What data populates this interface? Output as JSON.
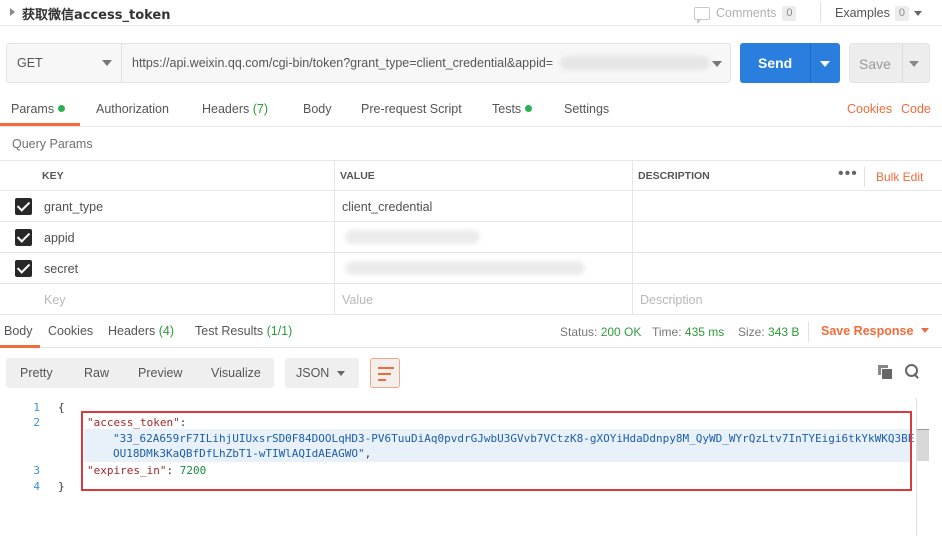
{
  "header": {
    "title": "获取微信access_token",
    "comments_label": "Comments",
    "comments_count": "0",
    "examples_label": "Examples",
    "examples_count": "0"
  },
  "request": {
    "method": "GET",
    "url": "https://api.weixin.qq.com/cgi-bin/token?grant_type=client_credential&appid=",
    "send_label": "Send",
    "save_label": "Save"
  },
  "request_tabs": {
    "params": "Params",
    "authorization": "Authorization",
    "headers": "Headers",
    "headers_count": "(7)",
    "body": "Body",
    "prerequest": "Pre-request Script",
    "tests": "Tests",
    "settings": "Settings",
    "cookies": "Cookies",
    "code": "Code"
  },
  "query_params": {
    "title": "Query Params",
    "columns": [
      "KEY",
      "VALUE",
      "DESCRIPTION"
    ],
    "bulk_edit": "Bulk Edit",
    "more": "•••",
    "rows": [
      {
        "key": "grant_type",
        "value": "client_credential"
      },
      {
        "key": "appid",
        "value": ""
      },
      {
        "key": "secret",
        "value": ""
      }
    ],
    "placeholder": {
      "key": "Key",
      "value": "Value",
      "description": "Description"
    }
  },
  "response_tabs": {
    "body": "Body",
    "cookies": "Cookies",
    "headers": "Headers",
    "headers_count": "(4)",
    "test_results": "Test Results",
    "test_results_count": "(1/1)",
    "status_label": "Status:",
    "status_value": "200 OK",
    "time_label": "Time:",
    "time_value": "435 ms",
    "size_label": "Size:",
    "size_value": "343 B",
    "save_response": "Save Response"
  },
  "view": {
    "pretty": "Pretty",
    "raw": "Raw",
    "preview": "Preview",
    "visualize": "Visualize",
    "format": "JSON"
  },
  "code": {
    "line_numbers": [
      "1",
      "2",
      "3",
      "4"
    ],
    "open_brace": "{",
    "close_brace": "}",
    "key1": "\"access_token\"",
    "colon1": ":",
    "token_line1": "\"33_62A659rF7ILihjUIUxsrSD0F84DOOLqHD3-PV6TuuDiAq0pvdrGJwbU3GVvb7VCtzK8-gXOYiHdaDdnpy8M_QyWD_WYrQzLtv7InTYEigi6tkYkWKQ3BE",
    "token_line2": "OU18DMk3KaQBfDfLhZbT1-wTIWlAQIdAEAGWO\"",
    "comma": ",",
    "key2": "\"expires_in\"",
    "colon2": ": ",
    "expires_value": "7200"
  },
  "colors": {
    "accent": "#f26b3a",
    "send_blue": "#2a7fde",
    "status_green": "#2d9c3b",
    "highlight_red": "#d9393f"
  }
}
